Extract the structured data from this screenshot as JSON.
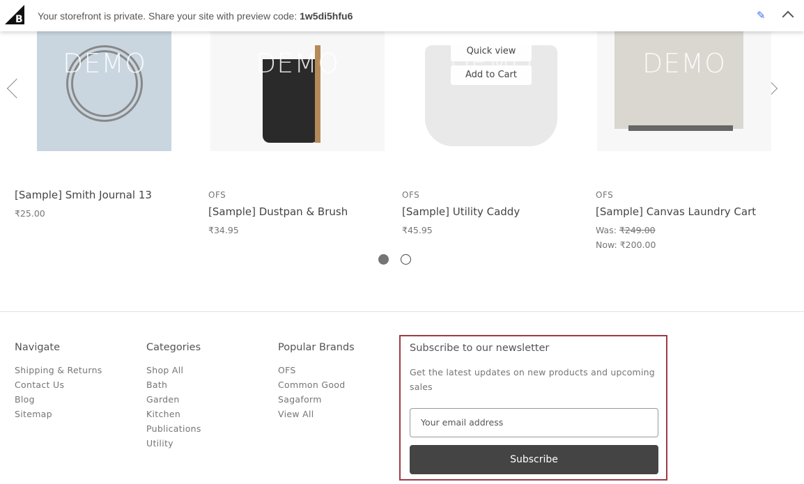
{
  "banner": {
    "message": "Your storefront is private. Share your site with preview code: ",
    "code": "1w5di5hfu6",
    "logo": "bigcommerce-logo",
    "edit_icon": "pencil-icon",
    "collapse_icon": "chevron-up-icon"
  },
  "carousel": {
    "watermark": "DEMO",
    "quick_view": "Quick view",
    "add_to_cart": "Add to Cart",
    "products": [
      {
        "brand": "",
        "name": "[Sample] Smith Journal 13",
        "price": "₹25.00"
      },
      {
        "brand": "OFS",
        "name": "[Sample] Dustpan & Brush",
        "price": "₹34.95"
      },
      {
        "brand": "OFS",
        "name": "[Sample] Utility Caddy",
        "price": "₹45.95"
      },
      {
        "brand": "OFS",
        "name": "[Sample] Canvas Laundry Cart",
        "was_label": "Was: ",
        "was_price": "₹249.00",
        "now": "Now: ₹200.00"
      }
    ],
    "active_page": 1,
    "pages": 2
  },
  "footer": {
    "navigate": {
      "title": "Navigate",
      "links": [
        "Shipping & Returns",
        "Contact Us",
        "Blog",
        "Sitemap"
      ]
    },
    "categories": {
      "title": "Categories",
      "links": [
        "Shop All",
        "Bath",
        "Garden",
        "Kitchen",
        "Publications",
        "Utility"
      ]
    },
    "brands": {
      "title": "Popular Brands",
      "links": [
        "OFS",
        "Common Good",
        "Sagaform",
        "View All"
      ]
    },
    "newsletter": {
      "title": "Subscribe to our newsletter",
      "description": "Get the latest updates on new products and upcoming sales",
      "placeholder": "Your email address",
      "button": "Subscribe",
      "highlight_color": "#9e3a46"
    }
  }
}
